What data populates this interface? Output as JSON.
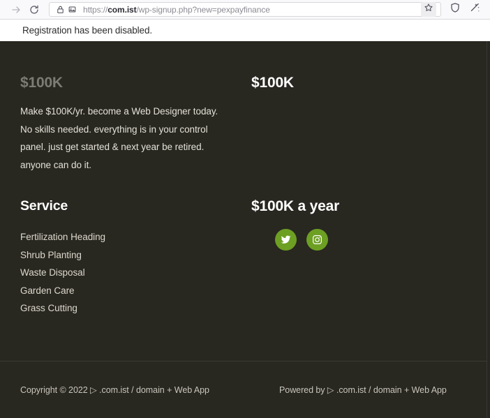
{
  "browser": {
    "forward_icon": "arrow-right-icon",
    "reload_icon": "reload-icon",
    "lock_icon": "padlock-icon",
    "permission_icon": "image-permission-icon",
    "url_scheme": "https://",
    "url_host": "com.ist",
    "url_path": "/wp-signup.php?new=pexpayfinance",
    "url_full": "https://com.ist/wp-signup.php?new=pexpayfinance",
    "star_icon": "bookmark-star-icon",
    "shield_icon": "tracking-protection-shield-icon",
    "sparkle_icon": "magic-wand-sparkle-icon"
  },
  "notice": {
    "message": "Registration has been disabled."
  },
  "page": {
    "background_color": "#282720",
    "accent_color": "#6d9f23",
    "widget_one": {
      "title": "$100K",
      "title_color": "#7d7c74",
      "body": "Make $100K/yr. become a Web Designer today. No skills needed. everything is in your control panel. just get started & next year be retired. anyone can do it."
    },
    "widget_two": {
      "title": "$100K",
      "title_color": "#ffffff"
    },
    "widget_three": {
      "title": "Service",
      "items": [
        "Fertilization Heading",
        "Shrub Planting",
        "Waste Disposal",
        "Garden Care",
        "Grass Cutting"
      ]
    },
    "widget_four": {
      "title": "$100K a year",
      "social": [
        {
          "name": "twitter-icon",
          "label": "Twitter"
        },
        {
          "name": "instagram-icon",
          "label": "Instagram"
        }
      ]
    },
    "footer": {
      "left_text": "Copyright © 2022 ▷ .com.ist / domain + Web App",
      "right_text": "Powered by ▷ .com.ist / domain + Web App"
    }
  }
}
